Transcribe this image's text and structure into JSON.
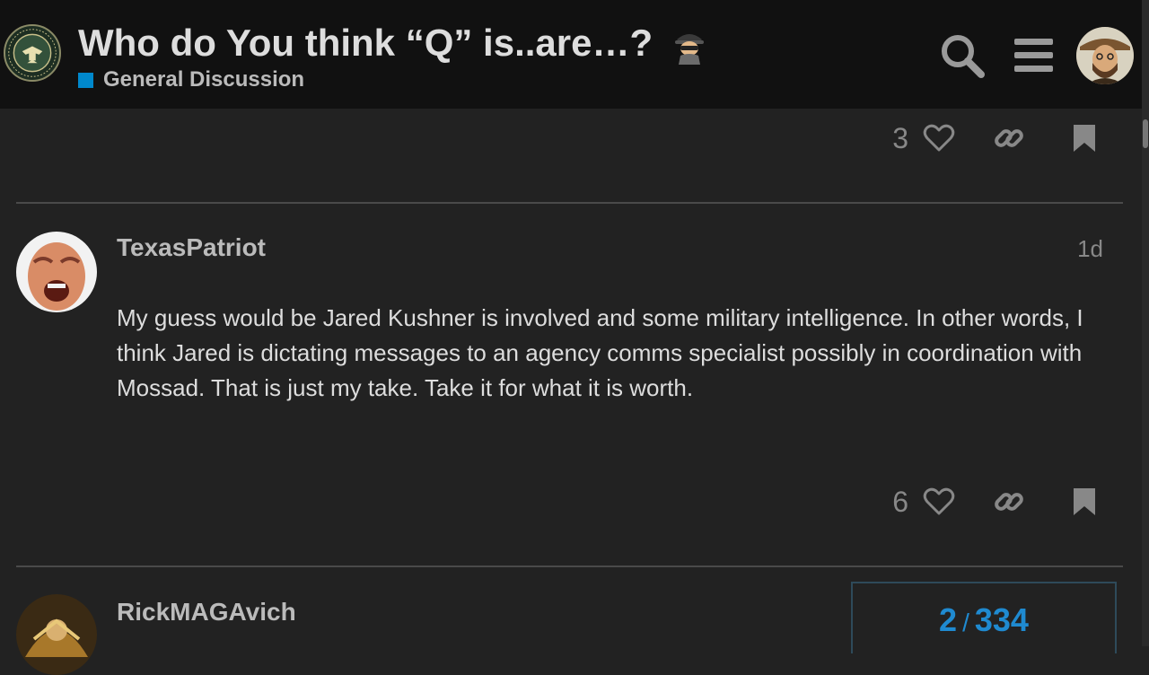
{
  "header": {
    "title": "Who do You think “Q” is..are…?",
    "title_emoji": "detective-emoji",
    "category": {
      "label": "General Discussion",
      "color": "#0088cc"
    },
    "logo": "infowars-army-logo",
    "search_icon": "search-icon",
    "menu_icon": "hamburger-menu-icon",
    "user_avatar": "user-avatar"
  },
  "previous_post_controls": {
    "like_count": "3"
  },
  "posts": [
    {
      "username": "TexasPatriot",
      "date": "1d",
      "body": "My guess would be Jared Kushner is involved and some military intelligence. In other words, I think Jared is dictating messages to an agency comms specialist possibly in coordination with Mossad. That is just my take. Take it for what it is worth.",
      "like_count": "6"
    },
    {
      "username": "RickMAGAvich"
    }
  ],
  "timeline": {
    "current": "2",
    "separator": "/",
    "total": "334"
  },
  "colors": {
    "background": "#222222",
    "header": "#111111",
    "accent": "#0088cc"
  }
}
